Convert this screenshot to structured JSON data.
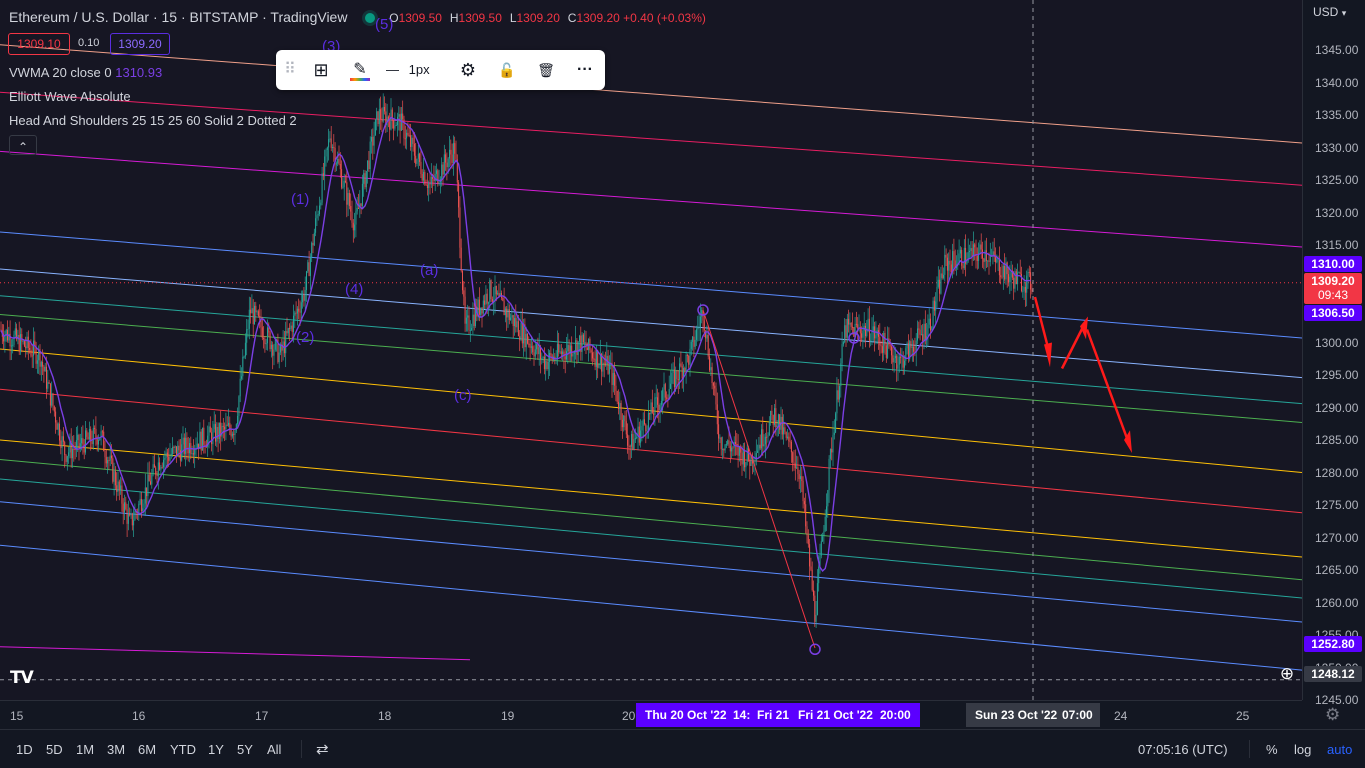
{
  "header": {
    "symbol": "Ethereum / U.S. Dollar · 15 · BITSTAMP · TradingView",
    "o_label": "O",
    "o_value": "1309.50",
    "h_label": "H",
    "h_value": "1309.50",
    "l_label": "L",
    "l_value": "1309.20",
    "c_label": "C",
    "c_value": "1309.20 +0.40 (+0.03%)",
    "bid": "1309.10",
    "spread": "0.10",
    "ask": "1309.20"
  },
  "indicators": {
    "vwma_label": "VWMA 20 close 0",
    "vwma_value": "1310.93",
    "elliott": "Elliott Wave Absolute",
    "hs": "Head And Shoulders 25 15 25 60 Solid 2 Dotted 2",
    "collapse_glyph": "⌃"
  },
  "toolbar": {
    "drag_glyph": "⠿",
    "layout_glyph": "⊞",
    "pencil_glyph": "✎",
    "line_glyph": "—",
    "width_label": "1px",
    "settings_glyph": "⚙",
    "lock_glyph": "🔓",
    "delete_glyph": "🗑",
    "more_glyph": "···"
  },
  "yaxis": {
    "currency": "USD",
    "currency_arrow": "▾",
    "ticks": [
      "1345.00",
      "1340.00",
      "1335.00",
      "1330.00",
      "1325.00",
      "1320.00",
      "1315.00",
      "1310.00",
      "1305.00",
      "1300.00",
      "1295.00",
      "1290.00",
      "1285.00",
      "1280.00",
      "1275.00",
      "1270.00",
      "1265.00",
      "1260.00",
      "1255.00",
      "1250.00",
      "1245.00"
    ],
    "label_1310": "1310.00",
    "label_price": "1309.20",
    "label_countdown": "09:43",
    "label_1306": "1306.50",
    "label_1252": "1252.80",
    "label_crosshair": "1248.12",
    "plus_glyph": "⊕"
  },
  "xaxis": {
    "ticks": [
      {
        "label": "15"
      },
      {
        "label": "16"
      },
      {
        "label": "17"
      },
      {
        "label": "18"
      },
      {
        "label": "19"
      },
      {
        "label": "20"
      },
      {
        "label": "24"
      },
      {
        "label": "25"
      }
    ],
    "range_highlight": [
      "Thu 20 Oct '22",
      "14:",
      "Fri 21",
      "Fri 21 Oct '22",
      "20:00"
    ],
    "crosshair_date": "Sun 23 Oct '22",
    "crosshair_time": "07:00",
    "settings_glyph": "⚙"
  },
  "waves": {
    "w1": "(1)",
    "w2": "(2)",
    "w3": "(3)",
    "w4": "(4)",
    "w5": "(5)",
    "wa": "(a)",
    "wc": "(c)"
  },
  "bottom": {
    "timeframes": [
      "1D",
      "5D",
      "1M",
      "3M",
      "6M",
      "YTD",
      "1Y",
      "5Y",
      "All"
    ],
    "compare_glyph": "⇄",
    "clock": "07:05:16 (UTC)",
    "pct": "%",
    "log": "log",
    "auto": "auto"
  },
  "logo": "TV",
  "colors": {
    "bg": "#161623",
    "up": "#26a69a",
    "down": "#ef5350",
    "vwma": "#7b3fe4",
    "price_label": "#f23645",
    "level_label": "#5b00ff",
    "auto": "#2962ff"
  }
}
